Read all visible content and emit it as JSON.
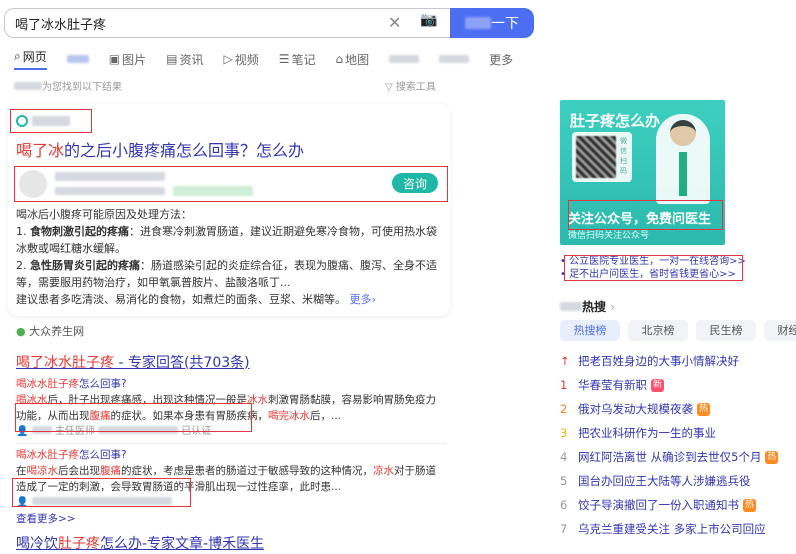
{
  "search": {
    "query": "喝了冰水肚子疼",
    "button_suffix": "一下"
  },
  "tabs": [
    {
      "label": "网页",
      "icon": "search-icon"
    },
    {
      "label": "图片",
      "icon": "image-icon"
    },
    {
      "label": "资讯",
      "icon": "news-icon"
    },
    {
      "label": "视频",
      "icon": "video-icon"
    },
    {
      "label": "笔记",
      "icon": "note-icon"
    },
    {
      "label": "地图",
      "icon": "map-icon"
    },
    {
      "label": "更多"
    }
  ],
  "meta": {
    "found": "为您找到以下结果",
    "tools": "搜索工具"
  },
  "card": {
    "title_hl": "喝了冰",
    "title_rest": "的之后小腹疼痛怎么回事？怎么办",
    "consult": "咨询",
    "intro": "喝冰后小腹疼可能原因及处理方法：",
    "p1_bold": "食物刺激引起的疼痛",
    "p1": "：进食寒冷刺激胃肠道，建议近期避免寒冷食物，可使用热水袋冰敷或喝红糖水缓解。",
    "p2_bold": "急性肠胃炎引起的疼痛",
    "p2": "：肠道感染引起的炎症综合征，表现为腹痛、腹泻、全身不适等，需要服用药物治疗，如甲氧氯普胺片、盐酸洛哌丁...",
    "p3": "建议患者多吃清淡、易消化的食物，如煮烂的面条、豆浆、米糊等。",
    "more": "更多"
  },
  "result2": {
    "site": "大众养生网",
    "title_hl": "喝了冰水肚子疼",
    "title_rest": " - 专家回答(共703条)",
    "q1_hl": "喝冰水肚子疼",
    "q1_rest": "怎么回事?",
    "a1": [
      "喝冰水",
      "后，肚子出现疼痛感，出现这种情况一般是",
      "冰水",
      "刺激胃肠黏膜，容易影响胃肠免疫力功能，从而出现",
      "腹痛",
      "的症状。如果本身患有胃肠疾病，",
      "喝完冰水",
      "后，..."
    ],
    "a1_verified": "已认证",
    "a1_role": "主任医师",
    "q2_hl": "喝冰水肚子疼",
    "q2_rest": "怎么回事?",
    "a2": [
      "在",
      "喝凉水",
      "后会出现",
      "腹痛",
      "的症状，考虑是患者的肠道过于敏感导致的这种情况，",
      "凉水",
      "对于肠道造成了一定的刺激，会导致胃肠道的平滑肌出现一过性痉挛，此时患..."
    ],
    "more": "查看更多>>"
  },
  "result3": {
    "p1": "喝冷饮",
    "hl": "肚子疼",
    "p2": "怎么办-专家文章-博禾医生"
  },
  "ad": {
    "title": "肚子疼怎么办",
    "qr_label": "微信扫码",
    "follow": "关注公众号，免费问医生",
    "follow_sub": "微信扫码关注公众号"
  },
  "ad_links": [
    "公立医院专业医生，一对一在线咨询>>",
    "足不出户问医生，省时省钱更省心>>"
  ],
  "hot": {
    "title": "热搜",
    "tabs": [
      "热搜榜",
      "北京榜",
      "民生榜",
      "财经榜"
    ],
    "items": [
      {
        "rank": "↑",
        "text": "把老百姓身边的大事小情解决好",
        "badge": ""
      },
      {
        "rank": "1",
        "text": "华春莹有新职",
        "badge": "新"
      },
      {
        "rank": "2",
        "text": "俄对乌发动大规模夜袭",
        "badge": "热"
      },
      {
        "rank": "3",
        "text": "把农业科研作为一生的事业",
        "badge": ""
      },
      {
        "rank": "4",
        "text": "网红阿浩离世 从确诊到去世仅5个月",
        "badge": "热"
      },
      {
        "rank": "5",
        "text": "国台办回应王大陆等人涉嫌逃兵役",
        "badge": ""
      },
      {
        "rank": "6",
        "text": "饺子导演撤回了一份入职通知书",
        "badge": "热"
      },
      {
        "rank": "7",
        "text": "乌克兰重建受关注 多家上市公司回应",
        "badge": ""
      }
    ]
  },
  "colors": {
    "accent": "#4e6ef2",
    "highlight": "#e53935",
    "teal": "#1fb8a6",
    "annotation": "#e0363f"
  }
}
